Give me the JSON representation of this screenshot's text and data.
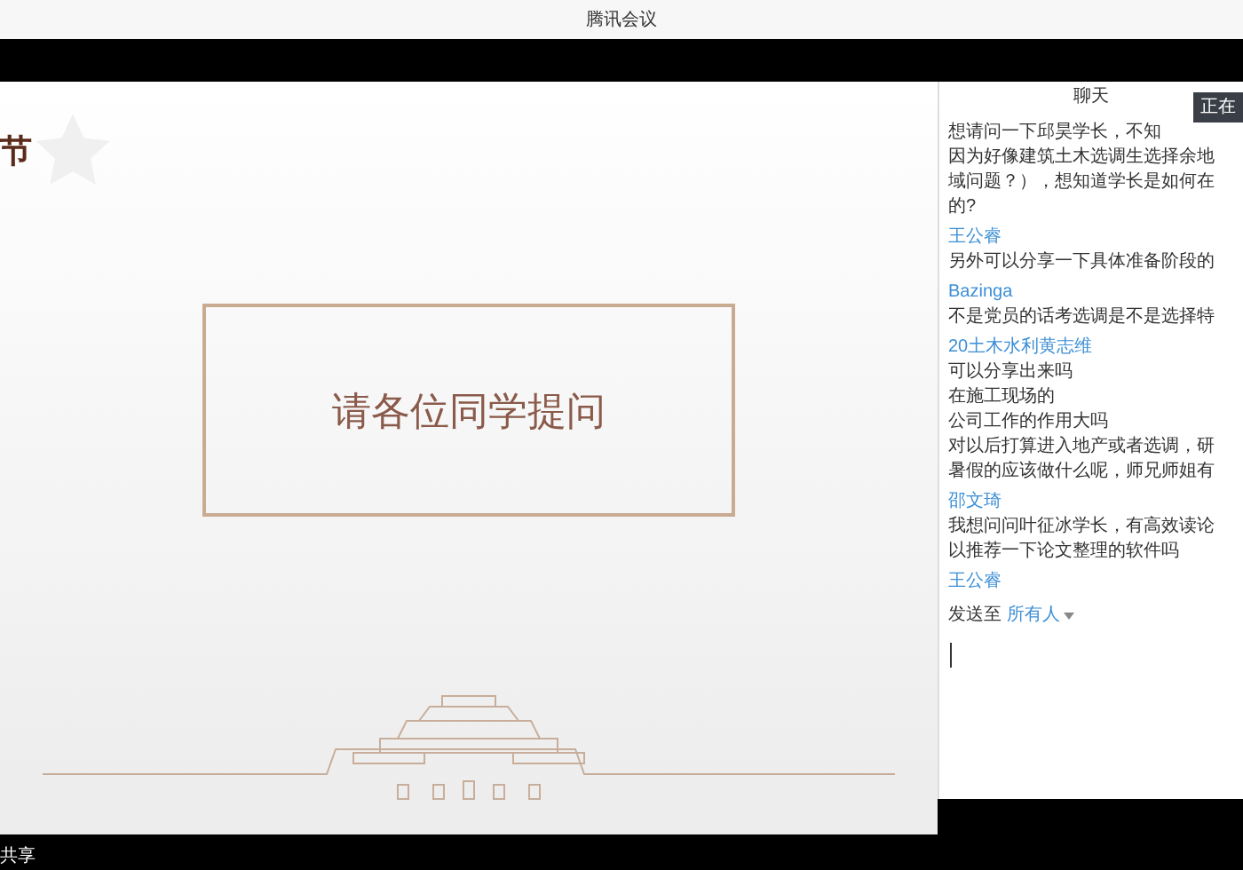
{
  "window": {
    "title": "腾讯会议"
  },
  "slide": {
    "corner_title": "节",
    "heading": "请各位同学提问"
  },
  "chat": {
    "title": "聊天",
    "speaking_badge": "正在",
    "messages": [
      {
        "lines": [
          "想请问一下邱昊学长，不知",
          "因为好像建筑土木选调生选择余地",
          "域问题？），想知道学长是如何在",
          "的?"
        ]
      },
      {
        "sender": "王公睿",
        "lines": [
          "另外可以分享一下具体准备阶段的"
        ]
      },
      {
        "sender": "Bazinga",
        "lines": [
          "不是党员的话考选调是不是选择特"
        ]
      },
      {
        "sender": "20土木水利黄志维",
        "lines": [
          "可以分享出来吗",
          "在施工现场的",
          "公司工作的作用大吗",
          "对以后打算进入地产或者选调，研",
          "暑假的应该做什么呢，师兄师姐有"
        ]
      },
      {
        "sender": "邵文琦",
        "lines": [
          "我想问问叶征冰学长，有高效读论",
          "以推荐一下论文整理的软件吗"
        ]
      },
      {
        "sender": "王公睿"
      }
    ],
    "send_to": {
      "label": "发送至",
      "target": "所有人"
    }
  },
  "bottom_bar": {
    "label": "共享"
  }
}
